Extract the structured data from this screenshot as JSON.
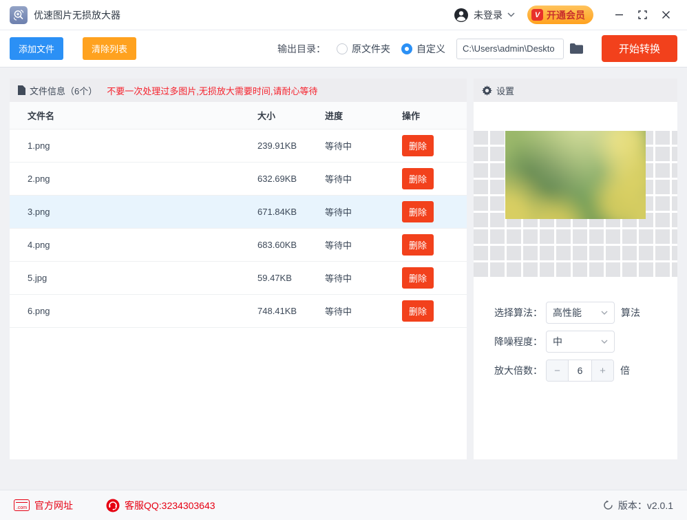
{
  "titlebar": {
    "app_title": "优速图片无损放大器",
    "login_label": "未登录",
    "vip_badge": "V",
    "vip_button": "开通会员",
    "minimize": "—",
    "close": "×"
  },
  "toolbar": {
    "add_button": "添加文件",
    "clear_button": "清除列表",
    "output_dir_label": "输出目录：",
    "radio_original": "原文件夹",
    "radio_custom": "自定义",
    "path_value": "C:\\Users\\admin\\Deskto",
    "start_button": "开始转换"
  },
  "file_panel": {
    "title": "文件信息（6个）",
    "warning": "不要一次处理过多图片,无损放大需要时间,请耐心等待",
    "columns": [
      "文件名",
      "大小",
      "进度",
      "操作"
    ],
    "rows": [
      {
        "name": "1.png",
        "size": "239.91KB",
        "status": "等待中",
        "action": "删除"
      },
      {
        "name": "2.png",
        "size": "632.69KB",
        "status": "等待中",
        "action": "删除"
      },
      {
        "name": "3.png",
        "size": "671.84KB",
        "status": "等待中",
        "action": "删除"
      },
      {
        "name": "4.png",
        "size": "683.60KB",
        "status": "等待中",
        "action": "删除"
      },
      {
        "name": "5.jpg",
        "size": "59.47KB",
        "status": "等待中",
        "action": "删除"
      },
      {
        "name": "6.png",
        "size": "748.41KB",
        "status": "等待中",
        "action": "删除"
      }
    ],
    "selected_row_index": 2
  },
  "settings_panel": {
    "title": "设置",
    "preview_image": "blurred-rapeseed-flowers-photo",
    "algorithm_label": "选择算法：",
    "algorithm_value": "高性能",
    "algorithm_suffix": "算法",
    "denoise_label": "降噪程度：",
    "denoise_value": "中",
    "scale_label": "放大倍数：",
    "scale_minus": "−",
    "scale_value": "6",
    "scale_plus": "+",
    "scale_suffix": "倍"
  },
  "footer": {
    "com_icon_text": ".com",
    "website_label": "官方网址",
    "qq_label": "客服QQ:3234303643",
    "version_label": "版本：v2.0.1"
  },
  "colors": {
    "accent_blue": "#2b90f5",
    "accent_orange": "#ffa21f",
    "accent_red_orange": "#f2411c",
    "warning_red": "#f5222d",
    "footer_red": "#e60012",
    "panel_header_bg": "#ededf0",
    "selected_row_bg": "#e8f4fd"
  }
}
